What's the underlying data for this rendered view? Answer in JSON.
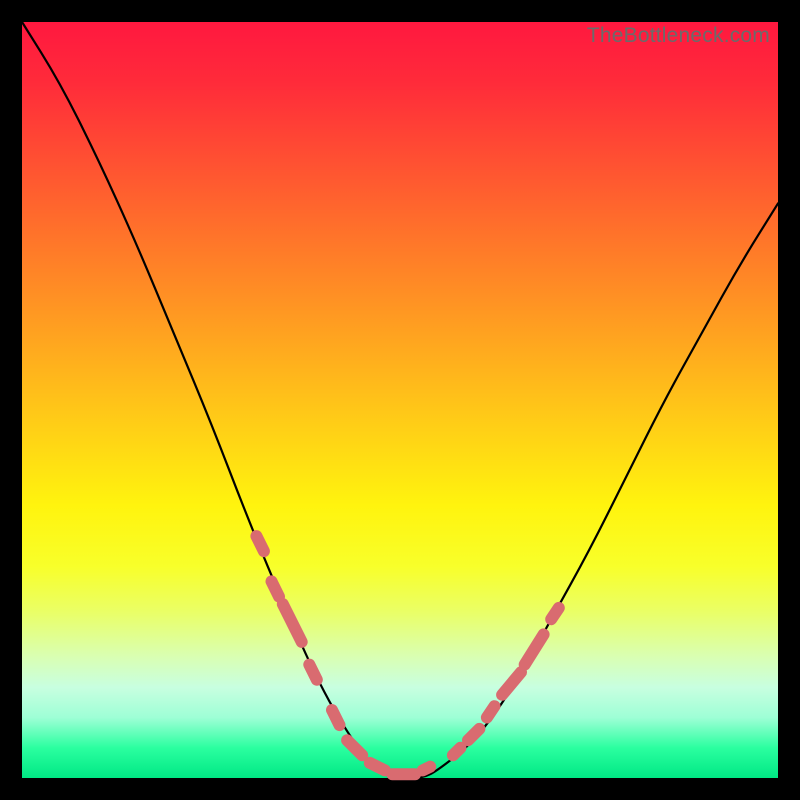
{
  "watermark": "TheBottleneck.com",
  "colors": {
    "gradient_top": "#ff183f",
    "gradient_bottom": "#00e884",
    "curve": "#000000",
    "marker": "#d96b70",
    "frame": "#000000"
  },
  "chart_data": {
    "type": "line",
    "title": "",
    "xlabel": "",
    "ylabel": "",
    "xlim": [
      0,
      100
    ],
    "ylim": [
      0,
      100
    ],
    "grid": false,
    "legend": false,
    "x": [
      0,
      5,
      10,
      15,
      20,
      25,
      30,
      35,
      40,
      45,
      47,
      50,
      53,
      55,
      60,
      65,
      70,
      75,
      80,
      85,
      90,
      95,
      100
    ],
    "y": [
      100,
      92,
      82,
      71,
      59,
      47,
      34,
      22,
      11,
      3,
      1,
      0,
      0,
      1,
      5,
      12,
      21,
      30,
      40,
      50,
      59,
      68,
      76
    ],
    "note": "y is bottleneck-percent; plotted curve minimum ~0 near x≈50–53",
    "markers": {
      "note": "salmon capsule markers overlaid on the curve",
      "segments": [
        {
          "x0": 31,
          "y0": 32,
          "x1": 32,
          "y1": 30
        },
        {
          "x0": 33,
          "y0": 26,
          "x1": 34,
          "y1": 24
        },
        {
          "x0": 34.5,
          "y0": 23,
          "x1": 37,
          "y1": 18
        },
        {
          "x0": 38,
          "y0": 15,
          "x1": 39,
          "y1": 13
        },
        {
          "x0": 41,
          "y0": 9,
          "x1": 42,
          "y1": 7
        },
        {
          "x0": 43,
          "y0": 5,
          "x1": 45,
          "y1": 3
        },
        {
          "x0": 46,
          "y0": 2,
          "x1": 48,
          "y1": 1
        },
        {
          "x0": 49,
          "y0": 0.5,
          "x1": 52,
          "y1": 0.5
        },
        {
          "x0": 53,
          "y0": 1,
          "x1": 54,
          "y1": 1.5
        },
        {
          "x0": 57,
          "y0": 3,
          "x1": 58,
          "y1": 4
        },
        {
          "x0": 59,
          "y0": 5,
          "x1": 60.5,
          "y1": 6.5
        },
        {
          "x0": 61.5,
          "y0": 8,
          "x1": 62.5,
          "y1": 9.5
        },
        {
          "x0": 63.5,
          "y0": 11,
          "x1": 66,
          "y1": 14
        },
        {
          "x0": 66.5,
          "y0": 15,
          "x1": 69,
          "y1": 19
        },
        {
          "x0": 70,
          "y0": 21,
          "x1": 71,
          "y1": 22.5
        }
      ]
    }
  }
}
